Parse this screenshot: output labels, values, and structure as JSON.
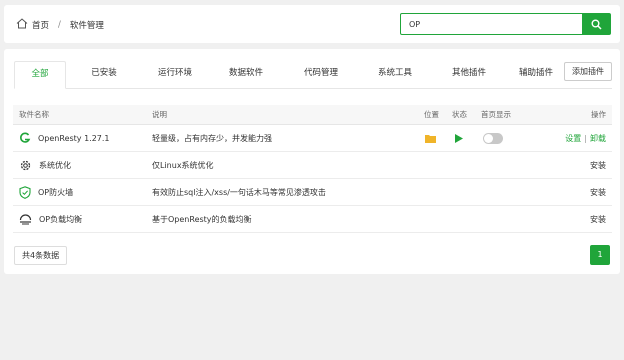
{
  "breadcrumb": {
    "home": "首页",
    "separator": "/",
    "current": "软件管理"
  },
  "search": {
    "value": "OP",
    "placeholder": ""
  },
  "tabs": [
    {
      "label": "全部",
      "active": true
    },
    {
      "label": "已安装"
    },
    {
      "label": "运行环境"
    },
    {
      "label": "数据软件"
    },
    {
      "label": "代码管理"
    },
    {
      "label": "系统工具"
    },
    {
      "label": "其他插件"
    },
    {
      "label": "辅助插件"
    }
  ],
  "add_plugin_label": "添加插件",
  "table": {
    "headers": {
      "name": "软件名称",
      "desc": "说明",
      "location": "位置",
      "status": "状态",
      "homepage": "首页显示",
      "ops": "操作"
    },
    "rows": [
      {
        "icon": "openresty-icon",
        "name": "OpenResty 1.27.1",
        "desc": "轻量级，占有内存少，并发能力强",
        "installed": true,
        "action_settings": "设置",
        "action_divider": "|",
        "action_uninstall": "卸载"
      },
      {
        "icon": "gear-icon",
        "name": "系统优化",
        "desc": "仅Linux系统优化",
        "installed": false,
        "action_install": "安装"
      },
      {
        "icon": "shield-icon",
        "name": "OP防火墙",
        "desc": "有效防止sql注入/xss/一句话木马等常见渗透攻击",
        "installed": false,
        "action_install": "安装"
      },
      {
        "icon": "balance-icon",
        "name": "OP负载均衡",
        "desc": "基于OpenResty的负载均衡",
        "installed": false,
        "action_install": "安装"
      }
    ]
  },
  "footer": {
    "count_text": "共4条数据",
    "current_page": "1"
  },
  "colors": {
    "accent": "#20a53a"
  }
}
